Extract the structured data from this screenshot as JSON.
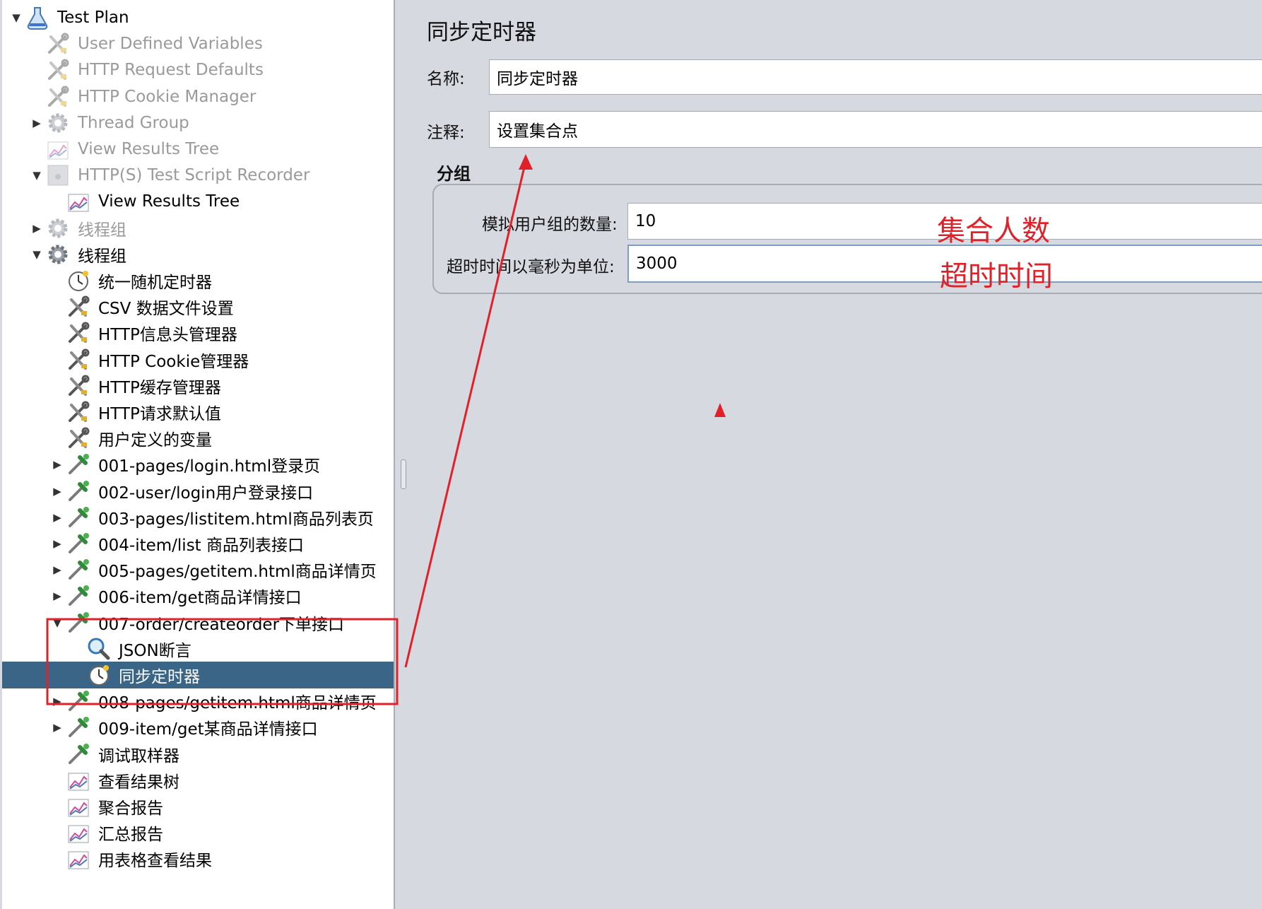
{
  "tree": {
    "items": [
      {
        "label": "Test Plan",
        "level": 0,
        "toggle": "▼",
        "icon": "flask-icon",
        "disabled": false
      },
      {
        "label": "User Defined Variables",
        "level": 1,
        "toggle": "",
        "icon": "wrench-icon",
        "disabled": true
      },
      {
        "label": "HTTP Request Defaults",
        "level": 1,
        "toggle": "",
        "icon": "wrench-icon",
        "disabled": true
      },
      {
        "label": "HTTP Cookie Manager",
        "level": 1,
        "toggle": "",
        "icon": "wrench-icon",
        "disabled": true
      },
      {
        "label": "Thread Group",
        "level": 1,
        "toggle": "▶",
        "icon": "gear-icon",
        "disabled": true
      },
      {
        "label": "View Results Tree",
        "level": 1,
        "toggle": "",
        "icon": "chart-icon",
        "disabled": true
      },
      {
        "label": "HTTP(S) Test Script Recorder",
        "level": 1,
        "toggle": "▼",
        "icon": "recorder-icon",
        "disabled": true
      },
      {
        "label": "View Results Tree",
        "level": 2,
        "toggle": "",
        "icon": "chart-icon",
        "disabled": false
      },
      {
        "label": "线程组",
        "level": 1,
        "toggle": "▶",
        "icon": "gear-icon",
        "disabled": true
      },
      {
        "label": "线程组",
        "level": 1,
        "toggle": "▼",
        "icon": "gear-icon",
        "disabled": false
      },
      {
        "label": "统一随机定时器",
        "level": 2,
        "toggle": "",
        "icon": "timer-icon",
        "disabled": false
      },
      {
        "label": "CSV 数据文件设置",
        "level": 2,
        "toggle": "",
        "icon": "wrench-icon",
        "disabled": false
      },
      {
        "label": "HTTP信息头管理器",
        "level": 2,
        "toggle": "",
        "icon": "wrench-icon",
        "disabled": false
      },
      {
        "label": "HTTP Cookie管理器",
        "level": 2,
        "toggle": "",
        "icon": "wrench-icon",
        "disabled": false
      },
      {
        "label": "HTTP缓存管理器",
        "level": 2,
        "toggle": "",
        "icon": "wrench-icon",
        "disabled": false
      },
      {
        "label": "HTTP请求默认值",
        "level": 2,
        "toggle": "",
        "icon": "wrench-icon",
        "disabled": false
      },
      {
        "label": "用户定义的变量",
        "level": 2,
        "toggle": "",
        "icon": "wrench-icon",
        "disabled": false
      },
      {
        "label": "001-pages/login.html登录页",
        "level": 2,
        "toggle": "▶",
        "icon": "pipette-icon",
        "disabled": false
      },
      {
        "label": "002-user/login用户登录接口",
        "level": 2,
        "toggle": "▶",
        "icon": "pipette-icon",
        "disabled": false
      },
      {
        "label": "003-pages/listitem.html商品列表页",
        "level": 2,
        "toggle": "▶",
        "icon": "pipette-icon",
        "disabled": false
      },
      {
        "label": "004-item/list 商品列表接口",
        "level": 2,
        "toggle": "▶",
        "icon": "pipette-icon",
        "disabled": false
      },
      {
        "label": "005-pages/getitem.html商品详情页",
        "level": 2,
        "toggle": "▶",
        "icon": "pipette-icon",
        "disabled": false
      },
      {
        "label": "006-item/get商品详情接口",
        "level": 2,
        "toggle": "▶",
        "icon": "pipette-icon",
        "disabled": false
      },
      {
        "label": "007-order/createorder下单接口",
        "level": 2,
        "toggle": "▼",
        "icon": "pipette-icon",
        "disabled": false
      },
      {
        "label": "JSON断言",
        "level": 3,
        "toggle": "",
        "icon": "magnifier-icon",
        "disabled": false
      },
      {
        "label": "同步定时器",
        "level": 3,
        "toggle": "",
        "icon": "timer-icon",
        "disabled": false,
        "selected": true
      },
      {
        "label": "008-pages/getitem.html商品详情页",
        "level": 2,
        "toggle": "▶",
        "icon": "pipette-icon",
        "disabled": false
      },
      {
        "label": "009-item/get某商品详情接口",
        "level": 2,
        "toggle": "▶",
        "icon": "pipette-icon",
        "disabled": false
      },
      {
        "label": "调试取样器",
        "level": 2,
        "toggle": "",
        "icon": "pipette-icon",
        "disabled": false
      },
      {
        "label": "查看结果树",
        "level": 2,
        "toggle": "",
        "icon": "chart-icon",
        "disabled": false
      },
      {
        "label": "聚合报告",
        "level": 2,
        "toggle": "",
        "icon": "chart-icon",
        "disabled": false
      },
      {
        "label": "汇总报告",
        "level": 2,
        "toggle": "",
        "icon": "chart-icon",
        "disabled": false
      },
      {
        "label": "用表格查看结果",
        "level": 2,
        "toggle": "",
        "icon": "chart-icon",
        "disabled": false
      }
    ]
  },
  "panel": {
    "title": "同步定时器",
    "name_label": "名称:",
    "name_value": "同步定时器",
    "comment_label": "注释:",
    "comment_value": "设置集合点",
    "group_title": "分组",
    "users_label": "模拟用户组的数量:",
    "users_value": "10",
    "timeout_label": "超时时间以毫秒为单位:",
    "timeout_value": "3000"
  },
  "annotations": {
    "users_note": "集合人数",
    "timeout_note": "超时时间"
  },
  "colors": {
    "selection": "#3b6587",
    "annotation": "#e0212a",
    "panel_bg": "#d6d9df"
  }
}
